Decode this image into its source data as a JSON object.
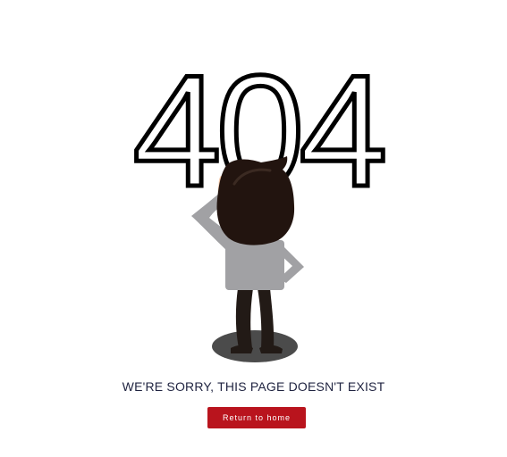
{
  "error_page": {
    "code": "404",
    "message": "WE'RE SORRY, THIS PAGE DOESN'T EXIST",
    "button_label": "Return to home"
  },
  "colors": {
    "background": "#ffffff",
    "text": "#1f2340",
    "digits": "#000000",
    "button": "#b9141d",
    "hair": "#22140f",
    "skin": "#f4c8a8",
    "shirt": "#a1a1a4",
    "pants": "#221a16",
    "shadow": "#4b4b4b"
  },
  "illustration": {
    "subject": "person-looking-at-404"
  }
}
